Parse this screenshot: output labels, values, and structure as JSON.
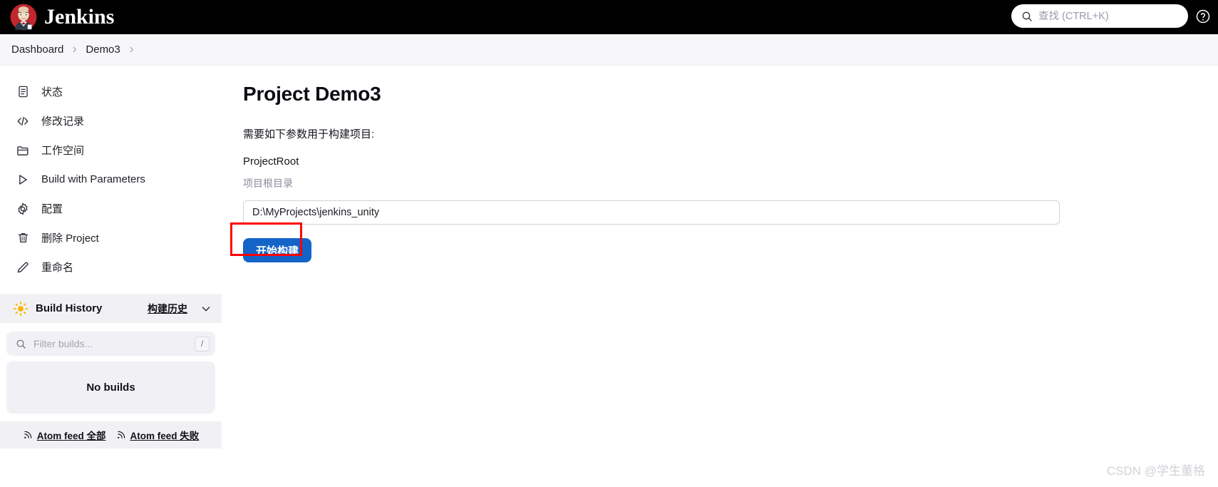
{
  "header": {
    "brand_name": "Jenkins",
    "logo_icon": "jenkins-butler-logo",
    "search": {
      "placeholder": "查找 (CTRL+K)",
      "value": "",
      "icon": "search-icon"
    },
    "help_icon": "help-circle-icon",
    "background_color": "#000000"
  },
  "breadcrumb": {
    "items": [
      {
        "label": "Dashboard"
      },
      {
        "label": "Demo3"
      }
    ],
    "separator_icon": "chevron-right-icon"
  },
  "sidebar": {
    "items": [
      {
        "label": "状态",
        "icon": "document-icon"
      },
      {
        "label": "修改记录",
        "icon": "code-brackets-icon"
      },
      {
        "label": "工作空间",
        "icon": "folder-icon"
      },
      {
        "label": "Build with Parameters",
        "icon": "play-triangle-icon"
      },
      {
        "label": "配置",
        "icon": "gear-icon"
      },
      {
        "label": "删除 Project",
        "icon": "trash-icon"
      },
      {
        "label": "重命名",
        "icon": "pencil-icon"
      }
    ],
    "build_history": {
      "title": "Build History",
      "link_label": "构建历史",
      "weather_icon": "sun-icon",
      "chevron_icon": "chevron-down-icon",
      "filter": {
        "placeholder": "Filter builds...",
        "value": "",
        "icon": "search-icon",
        "shortcut_key": "/"
      },
      "empty_message": "No builds",
      "feeds": [
        {
          "label": "Atom feed 全部",
          "icon": "rss-icon"
        },
        {
          "label": "Atom feed 失败",
          "icon": "rss-icon"
        }
      ]
    }
  },
  "main": {
    "page_title": "Project Demo3",
    "intro_text": "需要如下参数用于构建项目:",
    "parameter": {
      "name": "ProjectRoot",
      "description": "项目根目录",
      "value": "D:\\MyProjects\\jenkins_unity",
      "placeholder": ""
    },
    "build_button": {
      "label": "开始构建",
      "color": "#1464c8"
    },
    "annotation": {
      "shape": "rectangle",
      "color": "#ff0000"
    }
  },
  "watermark": {
    "text": "CSDN @学生董格"
  }
}
